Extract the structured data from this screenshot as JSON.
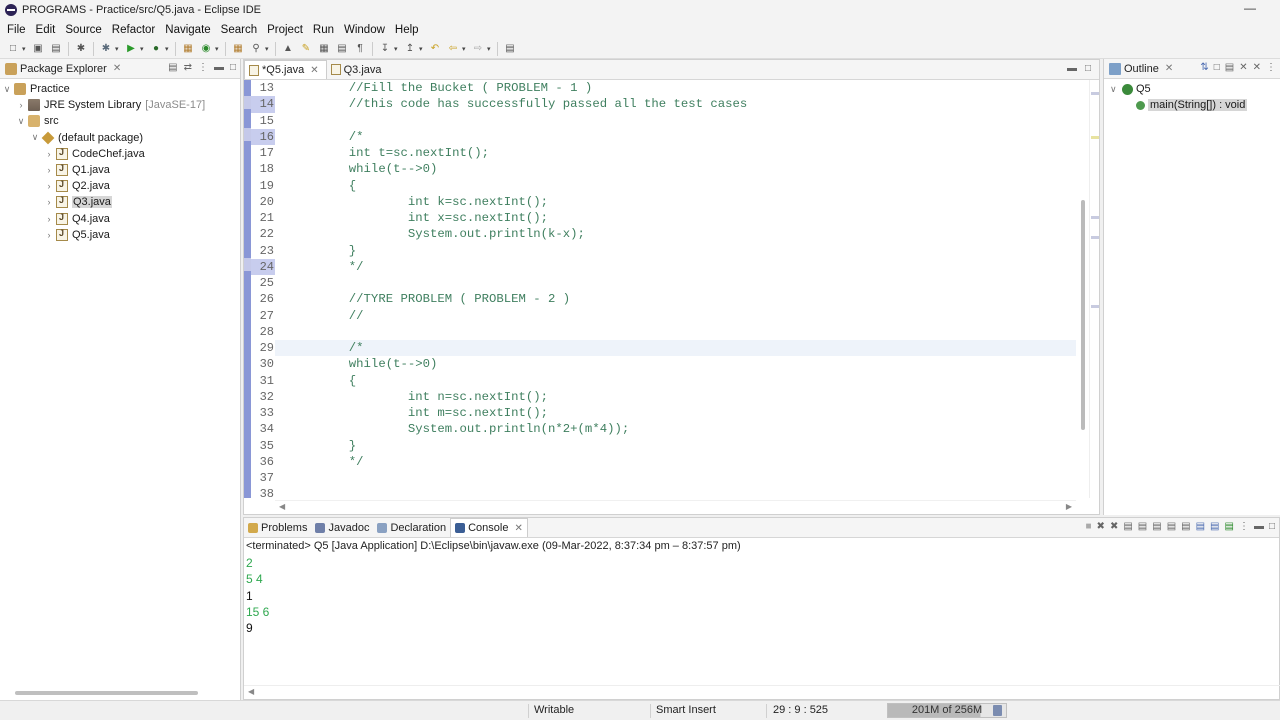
{
  "window": {
    "title": "PROGRAMS - Practice/src/Q5.java - Eclipse IDE"
  },
  "menu": [
    "File",
    "Edit",
    "Source",
    "Refactor",
    "Navigate",
    "Search",
    "Project",
    "Run",
    "Window",
    "Help"
  ],
  "package_explorer": {
    "tab_label": "Package Explorer",
    "tree": [
      {
        "label": "Practice",
        "extra": ""
      },
      {
        "label": "JRE System Library",
        "extra": "[JavaSE-17]"
      },
      {
        "label": "src",
        "extra": ""
      },
      {
        "label": "(default package)",
        "extra": ""
      },
      {
        "label": "CodeChef.java",
        "extra": ""
      },
      {
        "label": "Q1.java",
        "extra": ""
      },
      {
        "label": "Q2.java",
        "extra": ""
      },
      {
        "label": "Q3.java",
        "extra": ""
      },
      {
        "label": "Q4.java",
        "extra": ""
      },
      {
        "label": "Q5.java",
        "extra": ""
      }
    ]
  },
  "editor": {
    "tabs": [
      {
        "label": "*Q5.java"
      },
      {
        "label": "Q3.java"
      }
    ],
    "lines": [
      {
        "n": "13",
        "text": "//Fill the Bucket ( PROBLEM - 1 )"
      },
      {
        "n": "14",
        "text": "//this code has successfully passed all the test cases"
      },
      {
        "n": "15",
        "text": ""
      },
      {
        "n": "16",
        "text": "/*"
      },
      {
        "n": "17",
        "text": "int t=sc.nextInt();"
      },
      {
        "n": "18",
        "text": "while(t-->0)"
      },
      {
        "n": "19",
        "text": "{"
      },
      {
        "n": "20",
        "text": "        int k=sc.nextInt();"
      },
      {
        "n": "21",
        "text": "        int x=sc.nextInt();"
      },
      {
        "n": "22",
        "text": "        System.out.println(k-x);"
      },
      {
        "n": "23",
        "text": "}"
      },
      {
        "n": "24",
        "text": "*/"
      },
      {
        "n": "25",
        "text": ""
      },
      {
        "n": "26",
        "text": "//TYRE PROBLEM ( PROBLEM - 2 )"
      },
      {
        "n": "27",
        "text": "//"
      },
      {
        "n": "28",
        "text": ""
      },
      {
        "n": "29",
        "text": "/*"
      },
      {
        "n": "30",
        "text": "while(t-->0)"
      },
      {
        "n": "31",
        "text": "{"
      },
      {
        "n": "32",
        "text": "        int n=sc.nextInt();"
      },
      {
        "n": "33",
        "text": "        int m=sc.nextInt();"
      },
      {
        "n": "34",
        "text": "        System.out.println(n*2+(m*4));"
      },
      {
        "n": "35",
        "text": "}"
      },
      {
        "n": "36",
        "text": "*/"
      },
      {
        "n": "37",
        "text": ""
      },
      {
        "n": "38",
        "text": ""
      }
    ]
  },
  "outline": {
    "tab_label": "Outline",
    "class_label": "Q5",
    "method_label": "main(String[]) : void"
  },
  "console_panel": {
    "tabs": [
      "Problems",
      "Javadoc",
      "Declaration",
      "Console"
    ],
    "terminated": "<terminated> Q5 [Java Application] D:\\Eclipse\\bin\\javaw.exe  (09-Mar-2022, 8:37:34 pm – 8:37:57 pm)",
    "output": [
      {
        "text": "2",
        "kind": "input"
      },
      {
        "text": "5 4",
        "kind": "input"
      },
      {
        "text": "1",
        "kind": "output"
      },
      {
        "text": "15 6",
        "kind": "input"
      },
      {
        "text": "9",
        "kind": "output"
      }
    ]
  },
  "status": {
    "writable": "Writable",
    "insert_mode": "Smart Insert",
    "position": "29 : 9 : 525",
    "heap": "201M of 256M",
    "heap_used_fraction": 0.785
  }
}
